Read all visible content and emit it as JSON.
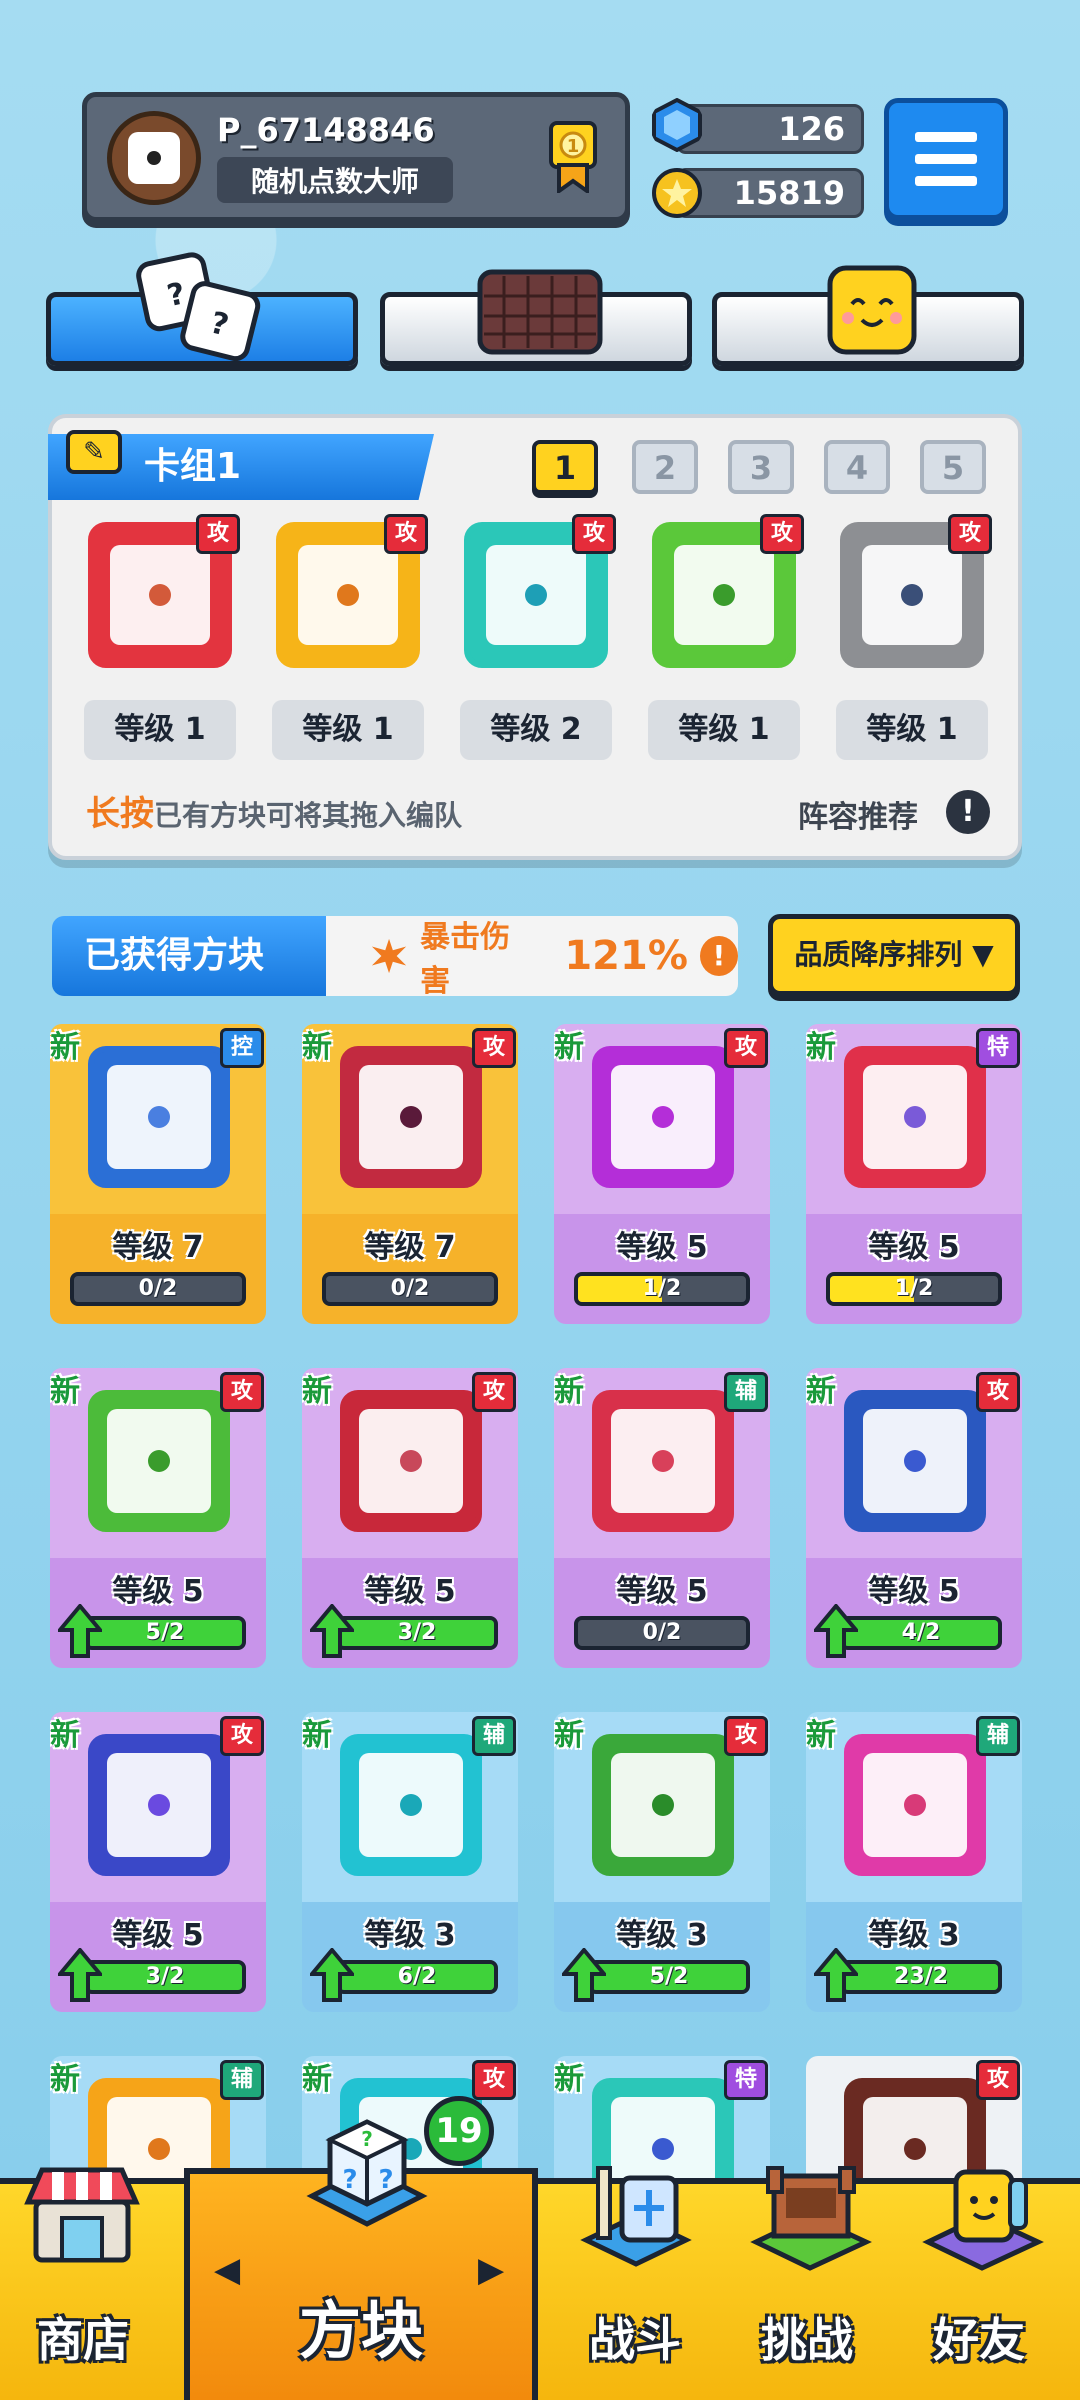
{
  "player": {
    "name": "P_67148846",
    "title": "随机点数大师",
    "gems": "126",
    "coins": "15819",
    "medal_number": "1"
  },
  "deck": {
    "title": "卡组1",
    "slots": [
      "1",
      "2",
      "3",
      "4",
      "5"
    ],
    "selected_slot": "1",
    "cards": [
      {
        "badge": "攻",
        "level": "等级 1",
        "color": "#e3343f",
        "dot": "#d35a3a"
      },
      {
        "badge": "攻",
        "level": "等级 1",
        "color": "#f6b418",
        "dot": "#e0781c"
      },
      {
        "badge": "攻",
        "level": "等级 2",
        "color": "#2bc7b8",
        "dot": "#1e9fb6"
      },
      {
        "badge": "攻",
        "level": "等级 1",
        "color": "#5bc83a",
        "dot": "#3a9c2c"
      },
      {
        "badge": "攻",
        "level": "等级 1",
        "color": "#8d8f93",
        "dot": "#3a4f78"
      }
    ],
    "hint_highlight": "长按",
    "hint_text": "已有方块可将其拖入编队",
    "recommend": "阵容推荐",
    "info_mark": "!"
  },
  "obtained": {
    "title": "已获得方块",
    "crit_label": "暴击伤害",
    "crit_value": "121%",
    "crit_info": "!",
    "sort_label": "品质降序排列 ▼"
  },
  "grid": {
    "new_label": "新",
    "rows": [
      [
        {
          "badge": "控",
          "type": "ctl",
          "level": "等级 7",
          "progress": "0/2",
          "fill": 0,
          "up": false,
          "tier": "gold",
          "color": "#2b6fd6",
          "dot": "#4a7fe0"
        },
        {
          "badge": "攻",
          "type": "atk",
          "level": "等级 7",
          "progress": "0/2",
          "fill": 0,
          "up": false,
          "tier": "gold",
          "color": "#c22a40",
          "dot": "#5a1a3a"
        },
        {
          "badge": "攻",
          "type": "atk",
          "level": "等级 5",
          "progress": "1/2",
          "fill": 0.5,
          "up": false,
          "tier": "purple",
          "color": "#b42ed8",
          "dot": "#b42ed8"
        },
        {
          "badge": "特",
          "type": "spc",
          "level": "等级 5",
          "progress": "1/2",
          "fill": 0.5,
          "up": false,
          "tier": "purple",
          "color": "#e0304a",
          "dot": "#7a5ad8"
        }
      ],
      [
        {
          "badge": "攻",
          "type": "atk",
          "level": "等级 5",
          "progress": "5/2",
          "fill": 1,
          "up": true,
          "tier": "purple",
          "color": "#4cbb3a",
          "dot": "#3a9c2c"
        },
        {
          "badge": "攻",
          "type": "atk",
          "level": "等级 5",
          "progress": "3/2",
          "fill": 1,
          "up": true,
          "tier": "purple",
          "color": "#c8283a",
          "dot": "#c8485a"
        },
        {
          "badge": "辅",
          "type": "sup",
          "level": "等级 5",
          "progress": "0/2",
          "fill": 0,
          "up": false,
          "tier": "purple",
          "color": "#d8304a",
          "dot": "#d8405a"
        },
        {
          "badge": "攻",
          "type": "atk",
          "level": "等级 5",
          "progress": "4/2",
          "fill": 1,
          "up": true,
          "tier": "purple",
          "color": "#2a58c0",
          "dot": "#3a5ad0"
        }
      ],
      [
        {
          "badge": "攻",
          "type": "atk",
          "level": "等级 5",
          "progress": "3/2",
          "fill": 1,
          "up": true,
          "tier": "purple",
          "color": "#3a48c8",
          "dot": "#6a4ae0"
        },
        {
          "badge": "辅",
          "type": "sup",
          "level": "等级 3",
          "progress": "6/2",
          "fill": 1,
          "up": true,
          "tier": "blue",
          "color": "#22c2d2",
          "dot": "#1aa8b8"
        },
        {
          "badge": "攻",
          "type": "atk",
          "level": "等级 3",
          "progress": "5/2",
          "fill": 1,
          "up": true,
          "tier": "blue",
          "color": "#3aa83a",
          "dot": "#2a8c2a"
        },
        {
          "badge": "辅",
          "type": "sup",
          "level": "等级 3",
          "progress": "23/2",
          "fill": 1,
          "up": true,
          "tier": "blue",
          "color": "#e03aa8",
          "dot": "#d83a78"
        }
      ],
      [
        {
          "badge": "辅",
          "type": "sup",
          "level": "",
          "progress": "",
          "fill": 0,
          "up": false,
          "tier": "blue",
          "color": "#f6a418",
          "dot": "#e0781c"
        },
        {
          "badge": "攻",
          "type": "atk",
          "level": "",
          "progress": "",
          "fill": 0,
          "up": false,
          "tier": "blue",
          "color": "#22c2d2",
          "dot": "#1aa8b8"
        },
        {
          "badge": "特",
          "type": "spc",
          "level": "",
          "progress": "",
          "fill": 0,
          "up": false,
          "tier": "blue",
          "color": "#2bc7b8",
          "dot": "#3a5ad0"
        },
        {
          "badge": "攻",
          "type": "atk",
          "level": "",
          "progress": "",
          "fill": 0,
          "up": false,
          "tier": "white",
          "color": "#6a2a22",
          "dot": "#6a2a22",
          "nonew": true
        }
      ]
    ]
  },
  "nav": {
    "shop": "商店",
    "blocks": "方块",
    "battle": "战斗",
    "challenge": "挑战",
    "friends": "好友",
    "left_arrow": "◀",
    "right_arrow": "▶",
    "notification_count": "19"
  },
  "colors": {
    "accent_blue": "#1e8af0",
    "accent_yellow": "#ffd21f",
    "gold_tier": "#f9c23a",
    "purple_tier": "#d8aef0",
    "blue_tier": "#a6dbf6"
  }
}
